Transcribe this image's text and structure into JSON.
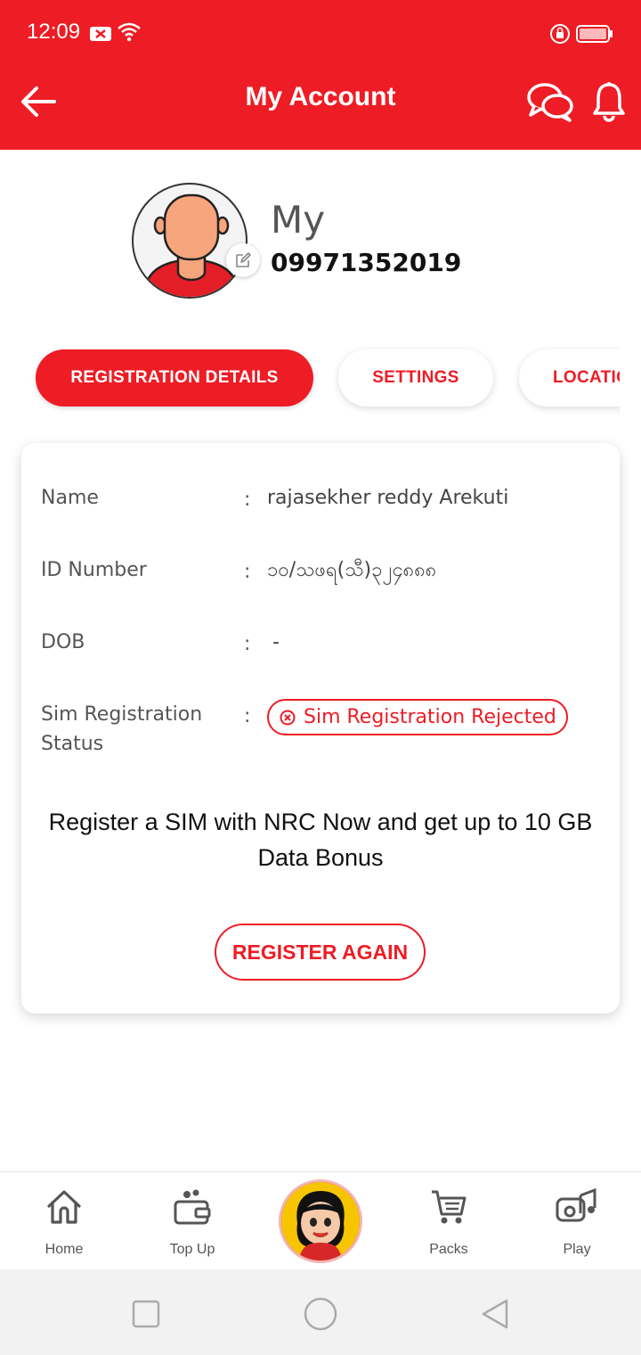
{
  "status_bar": {
    "time": "12:09"
  },
  "header": {
    "title": "My Account",
    "back_icon": "arrow-left-icon",
    "chat_icon": "chat-bubbles-icon",
    "bell_icon": "bell-icon"
  },
  "profile": {
    "name": "My",
    "number": "09971352019"
  },
  "tabs": [
    {
      "label": "REGISTRATION DETAILS",
      "active": true
    },
    {
      "label": "SETTINGS",
      "active": false
    },
    {
      "label": "LOCATION",
      "active": false
    }
  ],
  "details": {
    "rows": [
      {
        "label": "Name",
        "value": "rajasekher reddy Arekuti"
      },
      {
        "label": "ID Number",
        "value": "၁၀/သဖရ(သီ)၃၂၄၈၈၈"
      },
      {
        "label": "DOB",
        "value": "-"
      },
      {
        "label": "Sim Registration Status",
        "value": "Sim Registration Rejected"
      }
    ],
    "colon": ":",
    "promo_text": "Register a SIM with NRC Now and get up to 10 GB Data Bonus",
    "register_button": "REGISTER AGAIN"
  },
  "bottom_nav": [
    {
      "label": "Home",
      "icon": "home-icon"
    },
    {
      "label": "Top Up",
      "icon": "wallet-icon"
    },
    {
      "label": "",
      "icon": "mascot-girl-icon"
    },
    {
      "label": "Packs",
      "icon": "cart-icon"
    },
    {
      "label": "Play",
      "icon": "music-icon"
    }
  ],
  "colors": {
    "brand_red": "#ee1c25",
    "text_dark": "#111111",
    "text_muted": "#555555"
  }
}
